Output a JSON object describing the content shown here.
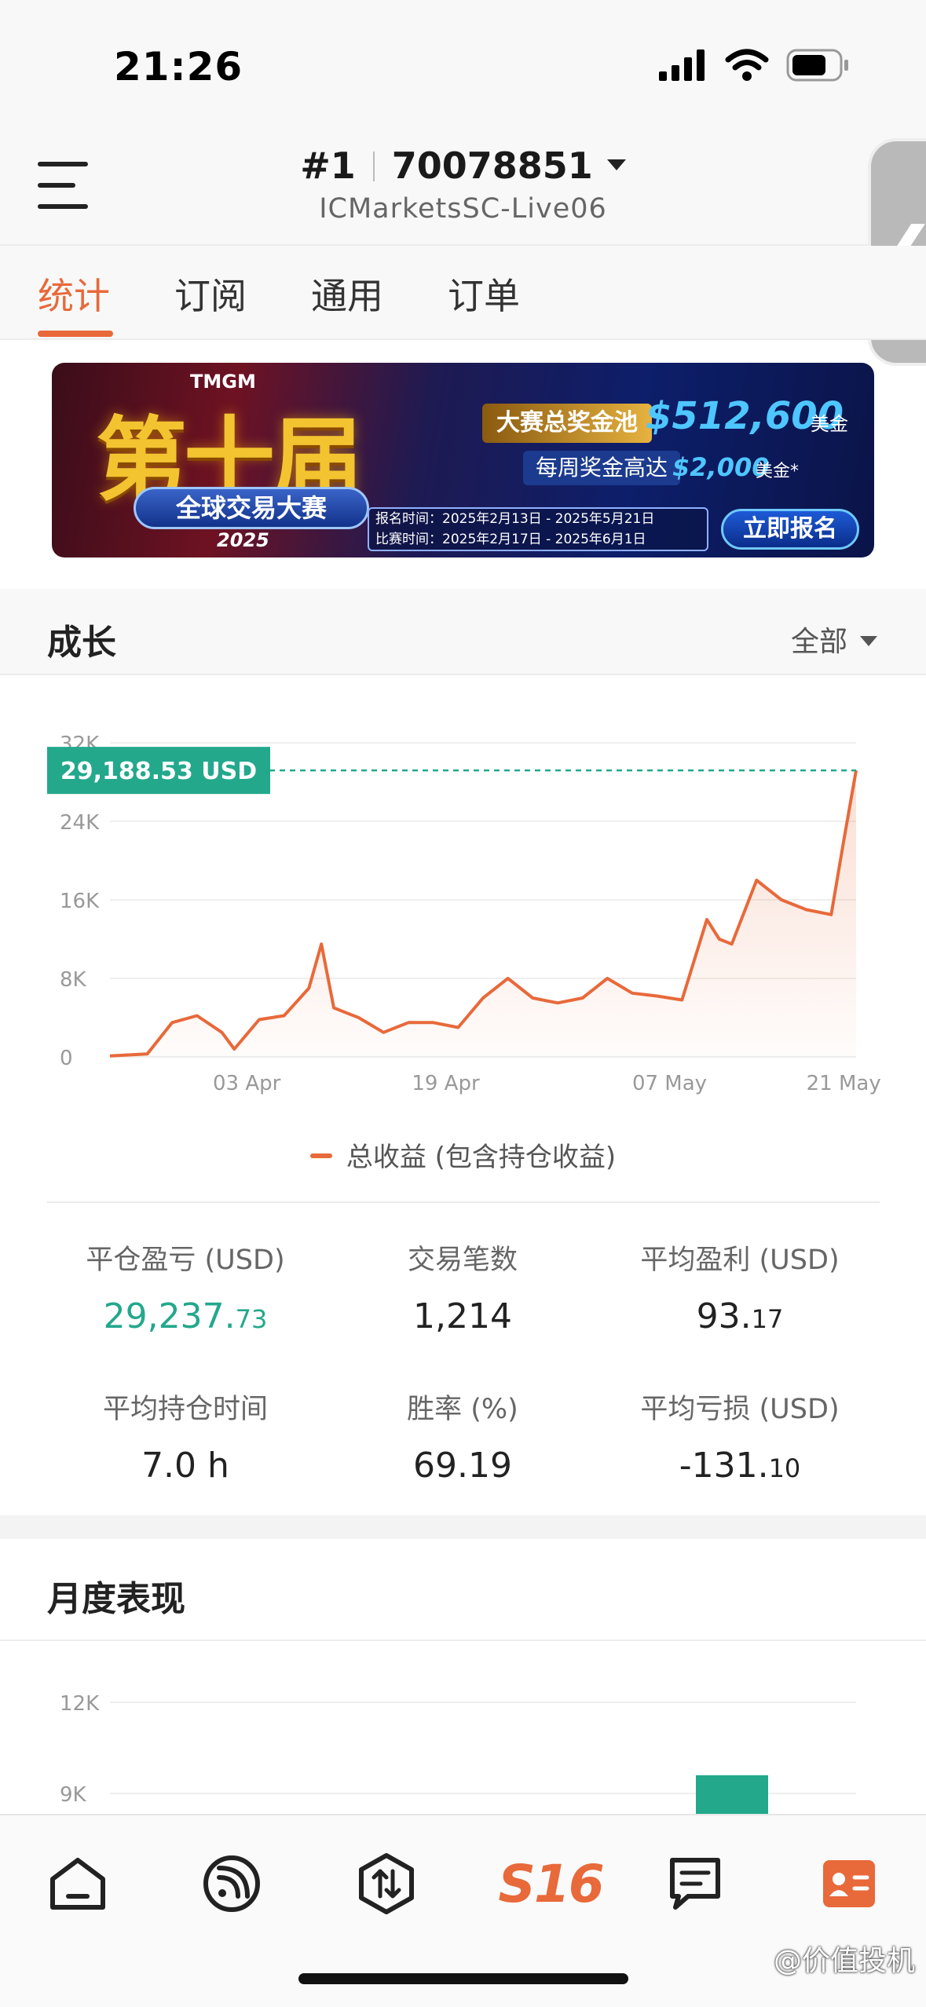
{
  "status_bar": {
    "time": "21:26"
  },
  "header": {
    "account_rank": "#1",
    "account_number": "70078851",
    "server": "ICMarketsSC-Live06"
  },
  "tabs": [
    {
      "label": "统计",
      "active": true
    },
    {
      "label": "订阅",
      "active": false
    },
    {
      "label": "通用",
      "active": false
    },
    {
      "label": "订单",
      "active": false
    }
  ],
  "banner": {
    "logo": "TMGM",
    "headline": "第十届",
    "subtitle": "全球交易大赛",
    "year": "2025",
    "pool_label": "大赛总奖金池",
    "pool_amount": "$512,600",
    "pool_unit": "美金",
    "weekly_label": "每周奖金高达",
    "weekly_amount": "$2,000",
    "weekly_unit": "美金*",
    "signup_period": "报名时间：2025年2月13日 - 2025年5月21日",
    "contest_period": "比赛时间：2025年2月17日 - 2025年6月1日",
    "signup_button": "立即报名"
  },
  "growth": {
    "title": "成长",
    "filter": "全部",
    "current_value_label": "29,188.53 USD",
    "legend": "总收益 (包含持仓收益)"
  },
  "chart_data": [
    {
      "type": "area",
      "title": "",
      "y_ticks": [
        "0",
        "8K",
        "16K",
        "24K",
        "32K"
      ],
      "ylim": [
        0,
        32000
      ],
      "x_ticks": [
        "03 Apr",
        "19 Apr",
        "07 May",
        "21 May"
      ],
      "x": [
        "2025-03-23",
        "2025-03-26",
        "2025-03-28",
        "2025-03-30",
        "2025-04-01",
        "2025-04-02",
        "2025-04-04",
        "2025-04-06",
        "2025-04-08",
        "2025-04-09",
        "2025-04-10",
        "2025-04-11",
        "2025-04-12",
        "2025-04-14",
        "2025-04-16",
        "2025-04-18",
        "2025-04-20",
        "2025-04-22",
        "2025-04-24",
        "2025-04-26",
        "2025-04-28",
        "2025-04-30",
        "2025-05-02",
        "2025-05-04",
        "2025-05-06",
        "2025-05-08",
        "2025-05-10",
        "2025-05-11",
        "2025-05-12",
        "2025-05-14",
        "2025-05-16",
        "2025-05-18",
        "2025-05-20",
        "2025-05-21",
        "2025-05-22"
      ],
      "series": [
        {
          "color": "#e8693a",
          "values": [
            100,
            300,
            3500,
            4200,
            2500,
            800,
            3800,
            4200,
            7000,
            11500,
            5000,
            4500,
            4000,
            2500,
            3500,
            3500,
            3000,
            6000,
            8000,
            6000,
            5500,
            6000,
            8000,
            6500,
            6200,
            5800,
            14000,
            12000,
            11500,
            18000,
            16000,
            15000,
            14500,
            22000,
            29188.53
          ]
        }
      ],
      "reference_line": 29188.53
    },
    {
      "type": "bar",
      "title": "",
      "y_ticks": [
        "9K",
        "12K"
      ],
      "ylim": [
        6000,
        12000
      ],
      "x": [
        "2025-05"
      ],
      "series": [
        {
          "color": "#23a88c",
          "values": [
            9000
          ]
        }
      ]
    }
  ],
  "stats": [
    {
      "label": "平仓盈亏 (USD)",
      "value_main": "29,237.",
      "value_dec": "73",
      "positive": true
    },
    {
      "label": "交易笔数",
      "value_main": "1,214",
      "value_dec": "",
      "positive": false
    },
    {
      "label": "平均盈利 (USD)",
      "value_main": "93.",
      "value_dec": "17",
      "positive": false
    },
    {
      "label": "平均持仓时间",
      "value_main": "7.0 h",
      "value_dec": "",
      "positive": false
    },
    {
      "label": "胜率 (%)",
      "value_main": "69.19",
      "value_dec": "",
      "positive": false
    },
    {
      "label": "平均亏损 (USD)",
      "value_main": "-131.",
      "value_dec": "10",
      "positive": false
    }
  ],
  "monthly": {
    "title": "月度表现"
  },
  "bottom_nav": {
    "items": [
      {
        "icon": "home-icon"
      },
      {
        "icon": "signal-icon"
      },
      {
        "icon": "trade-icon"
      },
      {
        "icon": "s16-logo",
        "label": "S16"
      },
      {
        "icon": "message-icon"
      },
      {
        "icon": "profile-card-icon",
        "active": true
      }
    ]
  },
  "watermark": "@价值投机",
  "colors": {
    "accent": "#e8693a",
    "positive": "#23a88c"
  }
}
